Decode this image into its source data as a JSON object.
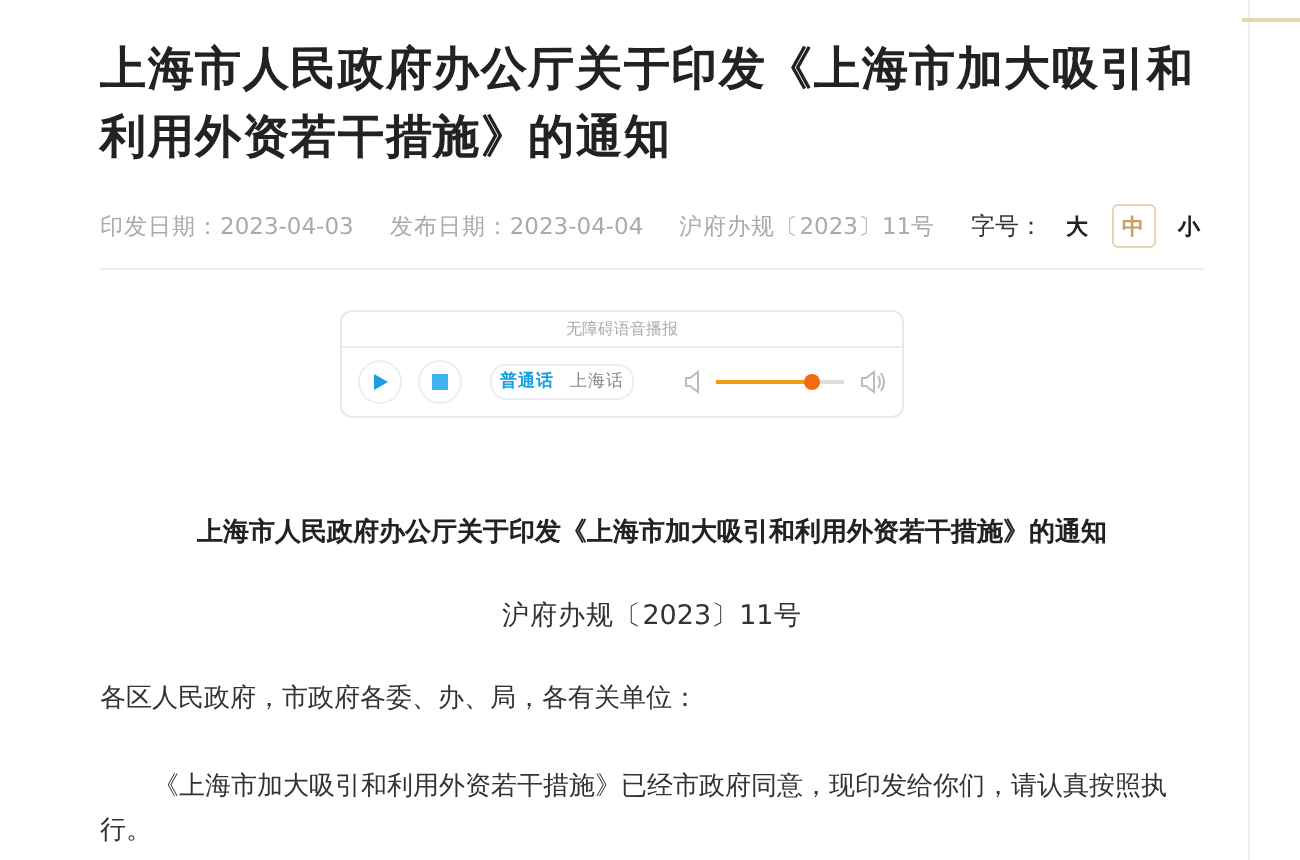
{
  "article": {
    "title": "上海市人民政府办公厅关于印发《上海市加大吸引和利用外资若干措施》的通知",
    "meta": [
      {
        "text": "印发日期：2023-04-03"
      },
      {
        "text": "发布日期：2023-04-04"
      },
      {
        "text": "沪府办规〔2023〕11号"
      }
    ],
    "font_size": {
      "label": "字号：",
      "options": [
        {
          "label": "大",
          "selected": false
        },
        {
          "label": "中",
          "selected": true
        },
        {
          "label": "小",
          "selected": false
        }
      ]
    }
  },
  "player": {
    "header": "无障碍语音播报",
    "languages": [
      {
        "label": "普通话",
        "selected": true
      },
      {
        "label": "上海话",
        "selected": false
      }
    ]
  },
  "body": {
    "heading": "上海市人民政府办公厅关于印发《上海市加大吸引和利用外资若干措施》的通知",
    "doc_number": "沪府办规〔2023〕11号",
    "salutation": "各区人民政府，市政府各委、办、局，各有关单位：",
    "paragraphs": [
      "《上海市加大吸引和利用外资若干措施》已经市政府同意，现印发给你们，请认真按照执行。"
    ]
  }
}
